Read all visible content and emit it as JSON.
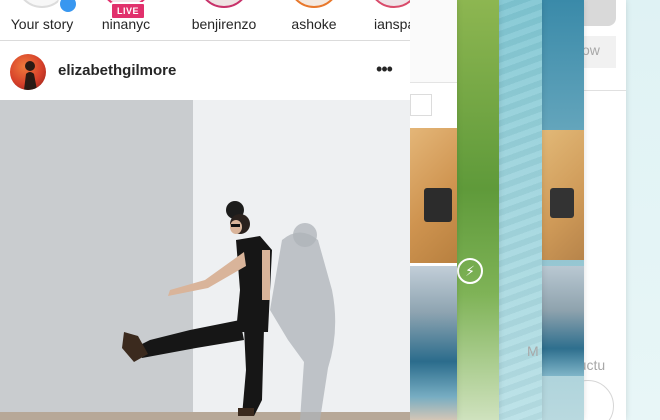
{
  "stories": [
    {
      "username": "Your story",
      "live": false,
      "ring": "#dcdcdc"
    },
    {
      "username": "ninanyc",
      "live": true,
      "live_label": "LIVE",
      "ring": "#e1306c"
    },
    {
      "username": "benjirenzo",
      "live": false,
      "ring": "#c8326a"
    },
    {
      "username": "ashoke",
      "live": false,
      "ring": "#e8782c"
    },
    {
      "username": "ianspa",
      "live": false,
      "ring": "#d94a6a"
    }
  ],
  "post": {
    "username": "elizabethgilmore",
    "more_icon": "more-horizontal-icon"
  },
  "background_cards": {
    "left_card_text": "M",
    "right_card_partial_text_top": "ow",
    "right_card_partial_text_bottom": "ructu"
  },
  "colors": {
    "live_badge": "#e1306c",
    "text": "#262626",
    "divider": "#dbdbdb"
  }
}
